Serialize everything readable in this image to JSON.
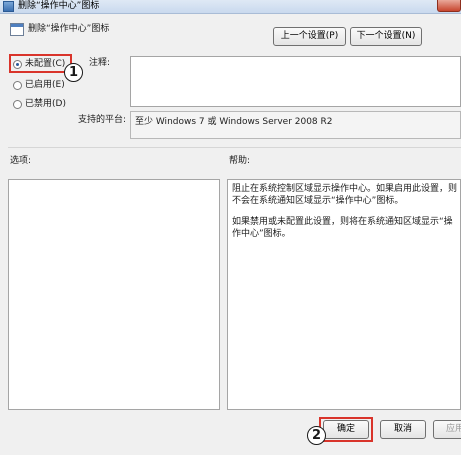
{
  "window": {
    "title": "删除“操作中心”图标"
  },
  "header": {
    "policy_name": "删除“操作中心”图标",
    "prev_button": "上一个设置(P)",
    "next_button": "下一个设置(N)"
  },
  "state": {
    "options": [
      {
        "label": "未配置(C)",
        "selected": true
      },
      {
        "label": "已启用(E)",
        "selected": false
      },
      {
        "label": "已禁用(D)",
        "selected": false
      }
    ]
  },
  "comment": {
    "label": "注释:",
    "value": ""
  },
  "platform": {
    "label": "支持的平台:",
    "value": "至少 Windows 7 或 Windows Server 2008 R2"
  },
  "options_section": {
    "label": "选项:"
  },
  "help_section": {
    "label": "帮助:",
    "paragraphs": [
      "阻止在系统控制区域显示操作中心。如果启用此设置，则不会在系统通知区域显示“操作中心”图标。",
      "如果禁用或未配置此设置，则将在系统通知区域显示“操作中心”图标。"
    ]
  },
  "footer": {
    "ok_button": "确定",
    "cancel_button": "取消",
    "apply_button": "应用"
  },
  "annotations": {
    "callout_1": "1",
    "callout_2": "2"
  },
  "colors": {
    "highlight": "#d9342b"
  }
}
